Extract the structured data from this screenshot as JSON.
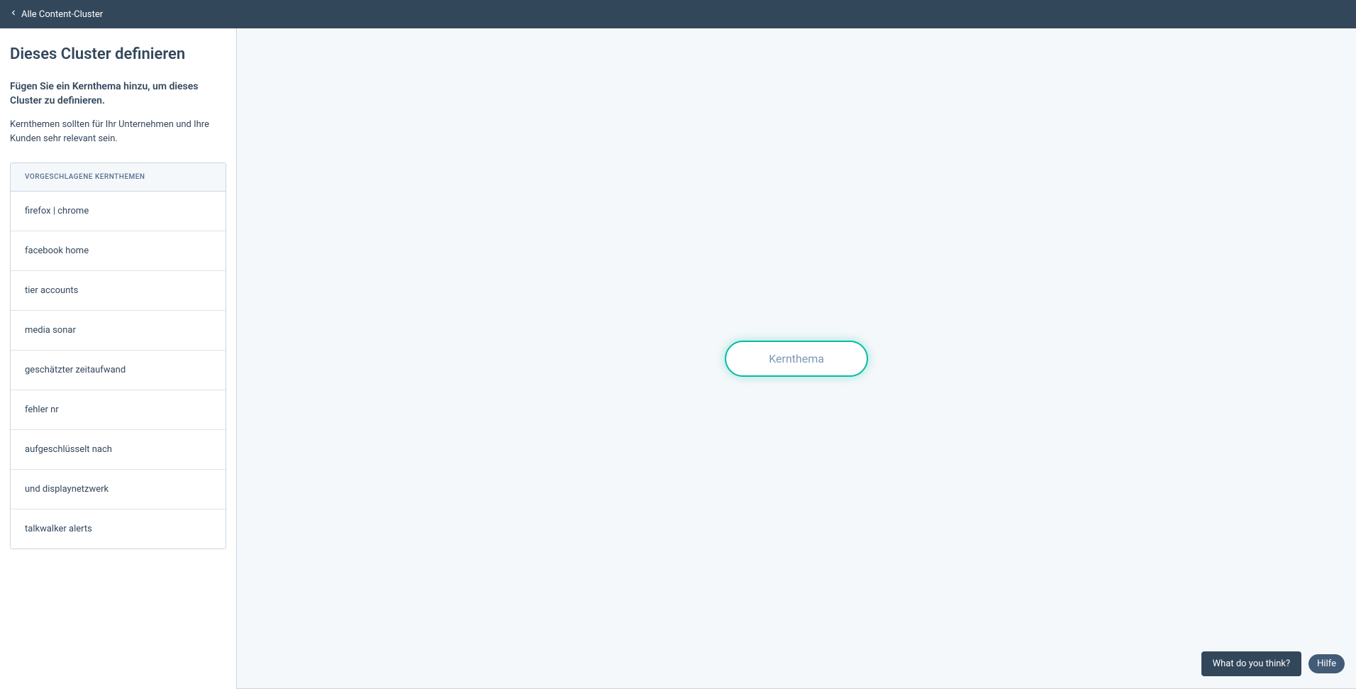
{
  "header": {
    "back_label": "Alle Content-Cluster"
  },
  "sidebar": {
    "title": "Dieses Cluster definieren",
    "subtitle": "Fügen Sie ein Kernthema hinzu, um dieses Cluster zu definieren.",
    "description": "Kernthemen sollten für Ihr Unternehmen und Ihre Kunden sehr relevant sein.",
    "suggestions_header": "VORGESCHLAGENE KERNTHEMEN",
    "suggestions": [
      "firefox | chrome",
      "facebook home",
      "tier accounts",
      "media sonar",
      "geschätzter zeitaufwand",
      "fehler nr",
      "aufgeschlüsselt nach",
      "und displaynetzwerk",
      "talkwalker alerts"
    ]
  },
  "content": {
    "core_topic_placeholder": "Kernthema"
  },
  "widgets": {
    "feedback_label": "What do you think?",
    "help_label": "Hilfe"
  }
}
